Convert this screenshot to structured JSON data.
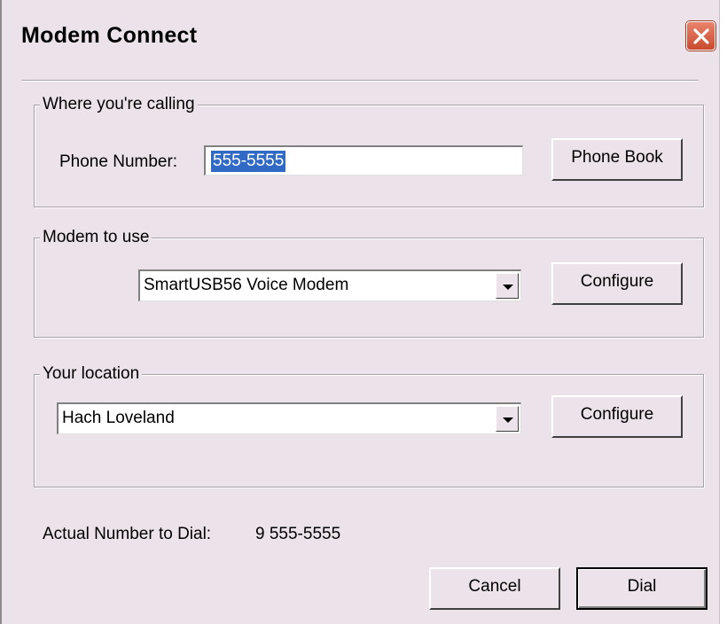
{
  "window": {
    "title": "Modem Connect",
    "close_icon": "close-x-icon"
  },
  "calling": {
    "legend": "Where you're calling",
    "phone_label": "Phone Number:",
    "phone_value": "555-5555",
    "phone_book_button": "Phone Book"
  },
  "modem": {
    "legend": "Modem to use",
    "selected": "SmartUSB56 Voice Modem",
    "configure_button": "Configure"
  },
  "location": {
    "legend": "Your location",
    "selected": "Hach Loveland",
    "configure_button": "Configure"
  },
  "dial_info": {
    "label": "Actual Number to Dial:",
    "value": "9 555-5555"
  },
  "footer": {
    "cancel_button": "Cancel",
    "dial_button": "Dial"
  }
}
